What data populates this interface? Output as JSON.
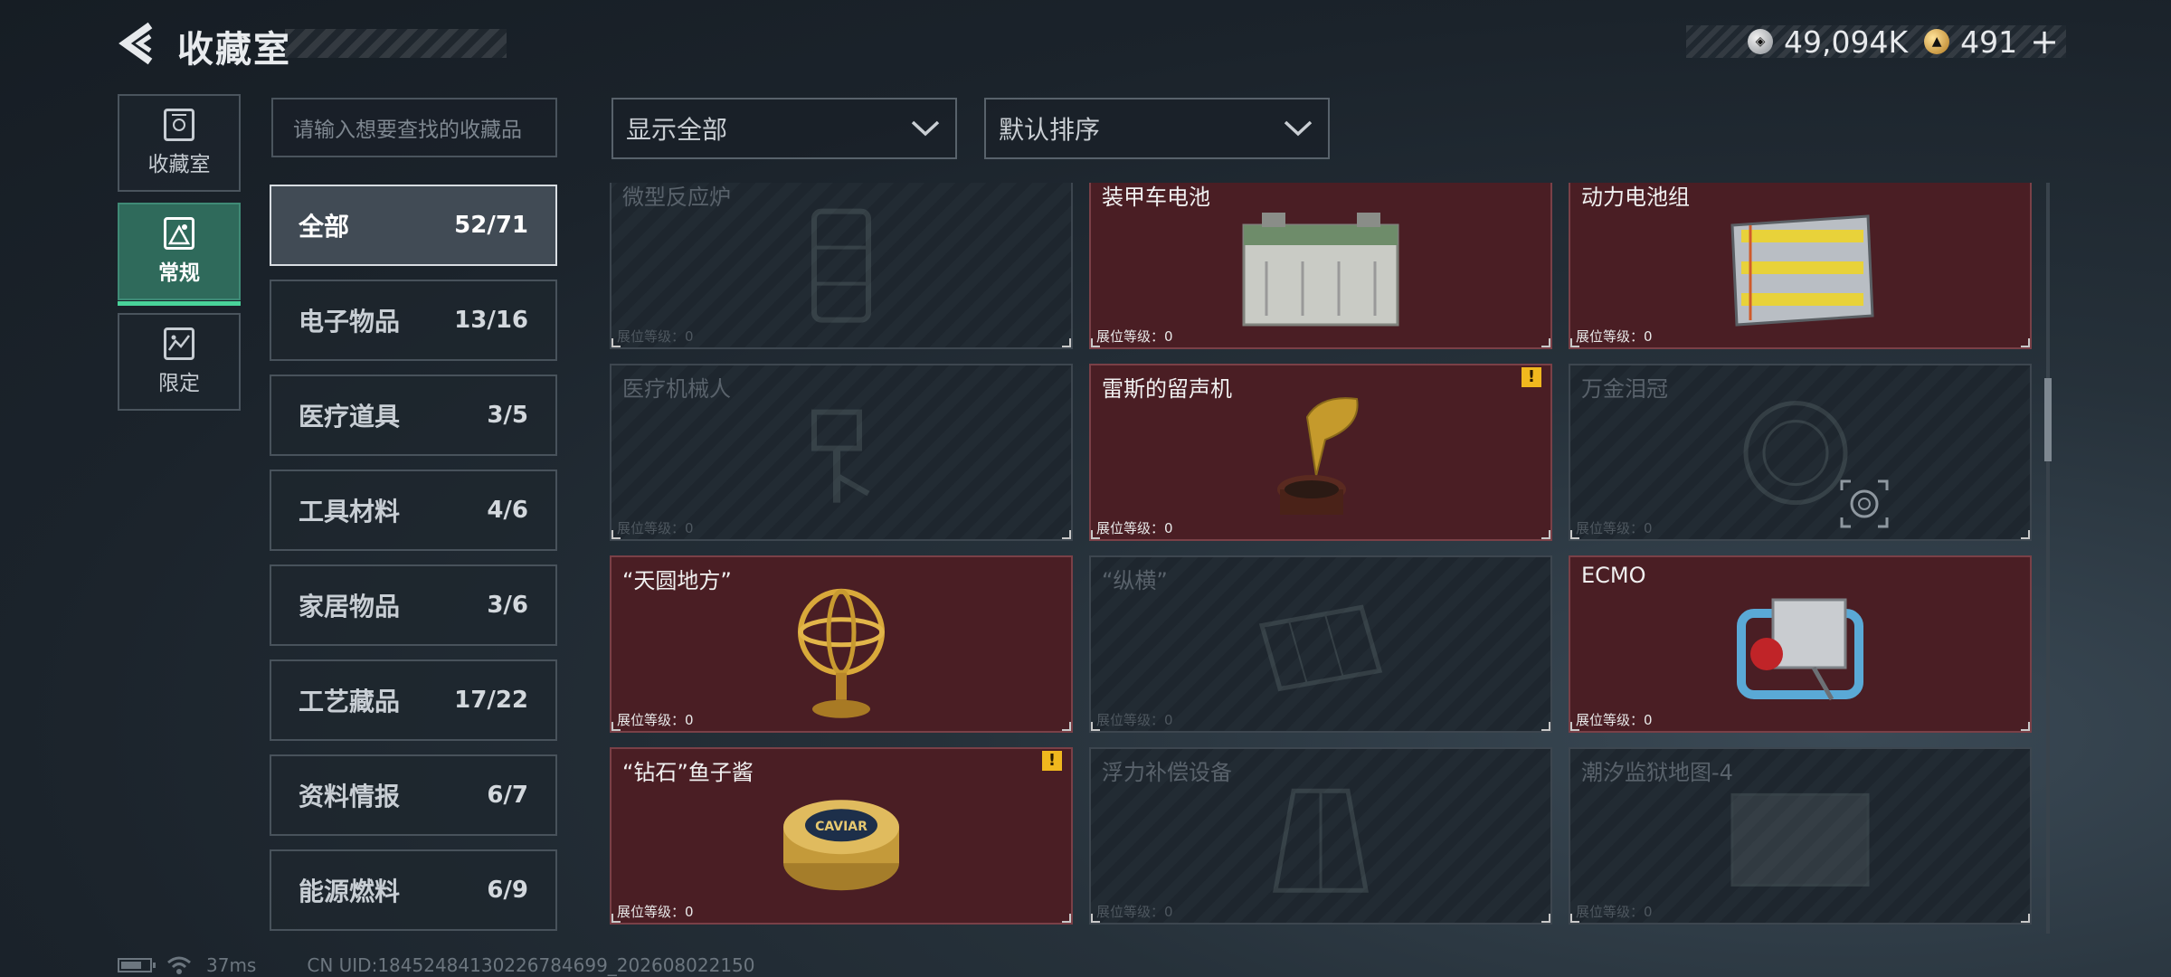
{
  "header": {
    "title": "收藏室",
    "currency_silver": "49,094K",
    "currency_gold": "491",
    "plus_label": "+"
  },
  "mode_tabs": [
    {
      "label": "收藏室",
      "icon": "collection-room-icon",
      "active": false
    },
    {
      "label": "常规",
      "icon": "regular-icon",
      "active": true
    },
    {
      "label": "限定",
      "icon": "limited-icon",
      "active": false
    }
  ],
  "search": {
    "placeholder": "请输入想要查找的收藏品"
  },
  "filters": {
    "display_selected": "显示全部",
    "sort_selected": "默认排序"
  },
  "categories": [
    {
      "name": "全部",
      "count": "52/71",
      "active": true
    },
    {
      "name": "电子物品",
      "count": "13/16"
    },
    {
      "name": "医疗道具",
      "count": "3/5"
    },
    {
      "name": "工具材料",
      "count": "4/6"
    },
    {
      "name": "家居物品",
      "count": "3/6"
    },
    {
      "name": "工艺藏品",
      "count": "17/22"
    },
    {
      "name": "资料情报",
      "count": "6/7"
    },
    {
      "name": "能源燃料",
      "count": "6/9"
    }
  ],
  "items": [
    {
      "name": "微型反应炉",
      "level": "展位等级：0",
      "owned": false,
      "icon": "reactor-icon"
    },
    {
      "name": "装甲车电池",
      "level": "展位等级：0",
      "owned": true,
      "icon": "car-battery-icon"
    },
    {
      "name": "动力电池组",
      "level": "展位等级：0",
      "owned": true,
      "icon": "battery-pack-icon"
    },
    {
      "name": "医疗机械人",
      "level": "展位等级：0",
      "owned": false,
      "icon": "medical-robot-icon"
    },
    {
      "name": "雷斯的留声机",
      "level": "展位等级：0",
      "owned": true,
      "warning": "!",
      "icon": "gramophone-icon"
    },
    {
      "name": "万金泪冠",
      "level": "展位等级：0",
      "owned": false,
      "icon": "crown-icon"
    },
    {
      "name": "“天圆地方”",
      "level": "展位等级：0",
      "owned": true,
      "icon": "armillary-sphere-icon"
    },
    {
      "name": "“纵横”",
      "level": "展位等级：0",
      "owned": false,
      "icon": "chessboard-icon"
    },
    {
      "name": "ECMO",
      "level": "展位等级：0",
      "owned": true,
      "icon": "ecmo-machine-icon"
    },
    {
      "name": "“钻石”鱼子酱",
      "level": "展位等级：0",
      "owned": true,
      "warning": "!",
      "icon": "caviar-tin-icon",
      "art_text": "CAVIAR"
    },
    {
      "name": "浮力补偿设备",
      "level": "展位等级：0",
      "owned": false,
      "icon": "bcd-vest-icon"
    },
    {
      "name": "潮汐监狱地图-4",
      "level": "展位等级：0",
      "owned": false,
      "icon": "map-icon"
    }
  ],
  "footer": {
    "ping": "37ms",
    "uid": "CN UID:18452484130226784699_202608022150"
  },
  "colors": {
    "owned_card": "#4a1e24",
    "active_tab": "#2f6a5b",
    "active_underline": "#49d39a",
    "warning": "#f0b81e"
  }
}
